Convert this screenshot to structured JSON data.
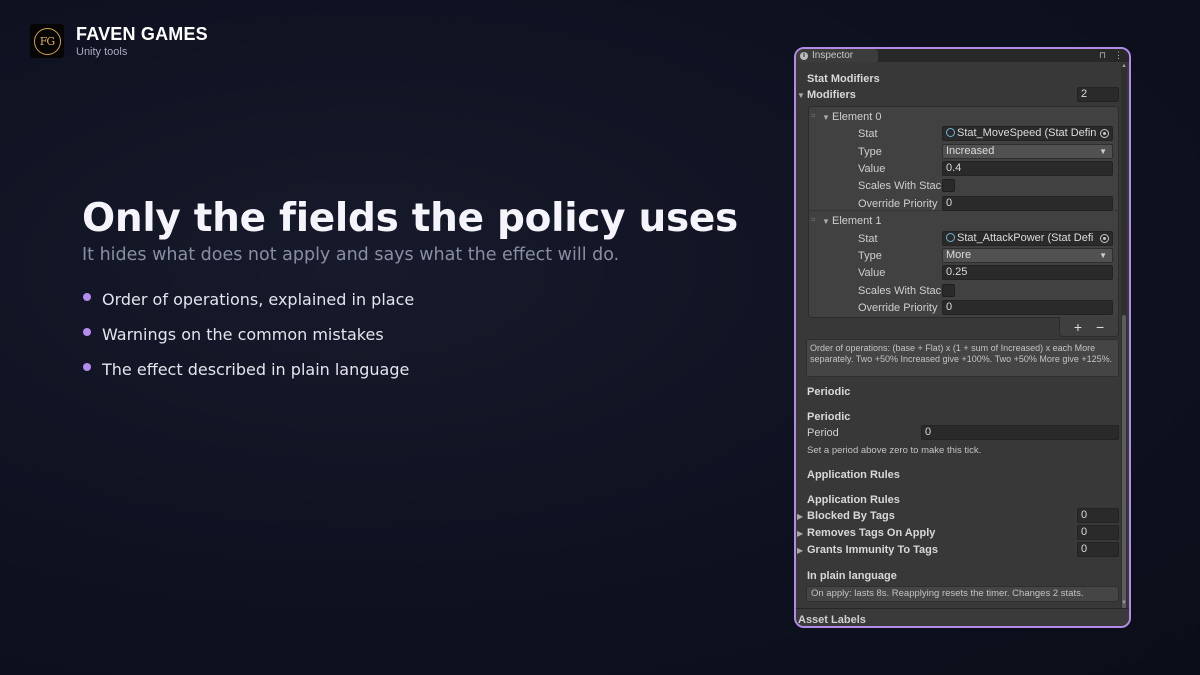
{
  "brand": {
    "logo_text": "FG",
    "name": "FAVEN GAMES",
    "tagline": "Unity tools"
  },
  "hero": {
    "title": "Only the fields the policy uses",
    "subtitle": "It hides what does not apply and says what the effect will do.",
    "bullets": [
      "Order of operations, explained in place",
      "Warnings on the common mistakes",
      "The effect described in plain language"
    ],
    "accent_color": "#b78cf0"
  },
  "inspector": {
    "tab_label": "Inspector",
    "border_color": "#b28be8",
    "stat_modifiers_header": "Stat Modifiers",
    "modifiers_label": "Modifiers",
    "modifiers_count": "2",
    "elements": [
      {
        "title": "Element 0",
        "stat_label": "Stat",
        "stat_value": "Stat_MoveSpeed (Stat Defin",
        "type_label": "Type",
        "type_value": "Increased",
        "value_label": "Value",
        "value_value": "0.4",
        "scales_label": "Scales With Stac",
        "override_label": "Override Priority",
        "override_value": "0"
      },
      {
        "title": "Element 1",
        "stat_label": "Stat",
        "stat_value": "Stat_AttackPower (Stat Defi",
        "type_label": "Type",
        "type_value": "More",
        "value_label": "Value",
        "value_value": "0.25",
        "scales_label": "Scales With Stac",
        "override_label": "Override Priority",
        "override_value": "0"
      }
    ],
    "add_label": "+",
    "remove_label": "−",
    "order_help": "Order of operations: (base + Flat) x (1 + sum of Increased) x each More separately. Two +50% Increased give +100%. Two +50% More give +125%.",
    "periodic_header": "Periodic",
    "periodic_subheader": "Periodic",
    "period_label": "Period",
    "period_value": "0",
    "period_help": "Set a period above zero to make this tick.",
    "application_header": "Application Rules",
    "application_subheader": "Application Rules",
    "blocked_label": "Blocked By Tags",
    "blocked_value": "0",
    "removes_label": "Removes Tags On Apply",
    "removes_value": "0",
    "grants_label": "Grants Immunity To Tags",
    "grants_value": "0",
    "plain_header": "In plain language",
    "plain_text": "On apply: lasts 8s. Reapplying resets the timer. Changes 2 stats.",
    "asset_labels": "Asset Labels"
  }
}
